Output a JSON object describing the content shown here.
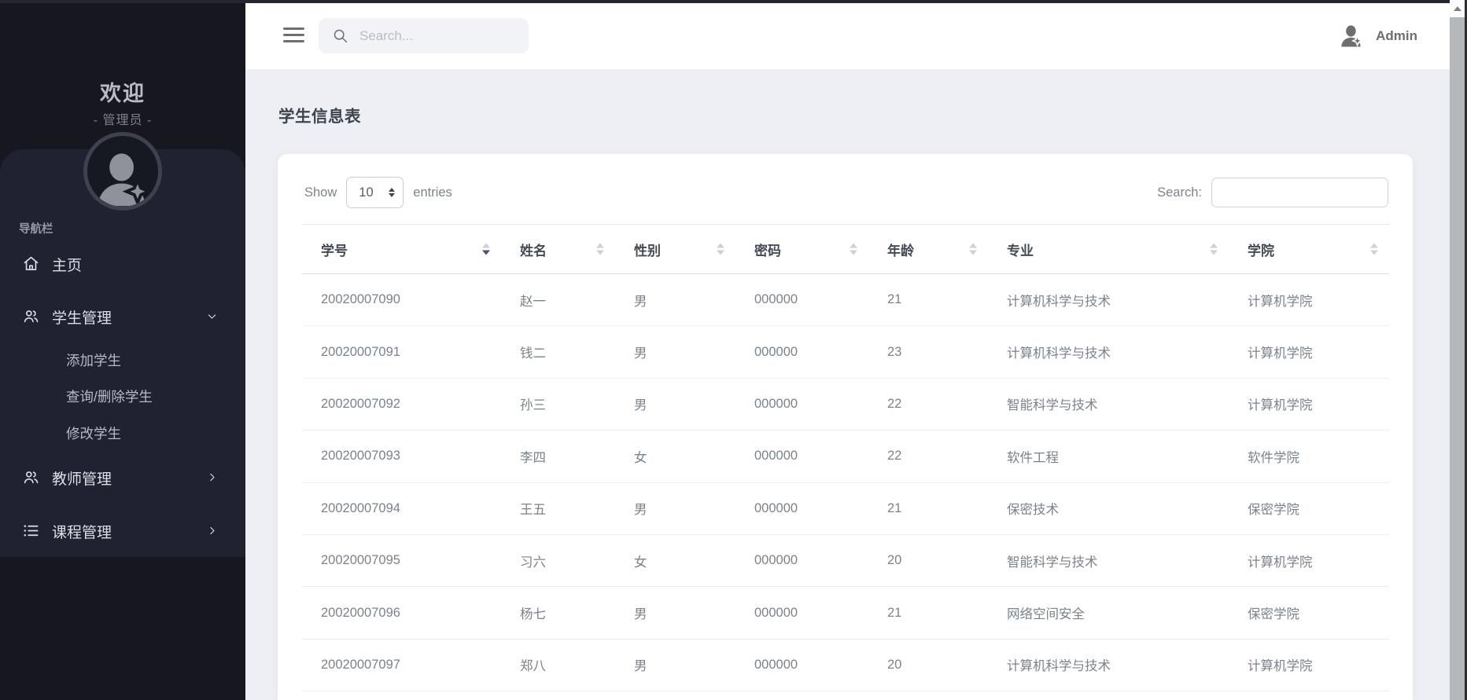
{
  "sidebar": {
    "welcome_title": "欢迎",
    "welcome_subtitle": "- 管理员 -",
    "nav_label": "导航栏",
    "home_label": "主页",
    "student_mgmt_label": "学生管理",
    "student_sub": {
      "add": "添加学生",
      "query_delete": "查询/删除学生",
      "modify": "修改学生"
    },
    "teacher_mgmt_label": "教师管理",
    "course_mgmt_label": "课程管理"
  },
  "topbar": {
    "search_placeholder": "Search...",
    "user_name": "Admin"
  },
  "page": {
    "title": "学生信息表"
  },
  "datatable": {
    "show_label": "Show",
    "entries_label": "entries",
    "page_length": "10",
    "search_label": "Search:",
    "search_value": "",
    "columns": [
      "学号",
      "姓名",
      "性别",
      "密码",
      "年龄",
      "专业",
      "学院"
    ],
    "rows": [
      {
        "id": "20020007090",
        "name": "赵一",
        "gender": "男",
        "password": "000000",
        "age": "21",
        "major": "计算机科学与技术",
        "college": "计算机学院"
      },
      {
        "id": "20020007091",
        "name": "钱二",
        "gender": "男",
        "password": "000000",
        "age": "23",
        "major": "计算机科学与技术",
        "college": "计算机学院"
      },
      {
        "id": "20020007092",
        "name": "孙三",
        "gender": "男",
        "password": "000000",
        "age": "22",
        "major": "智能科学与技术",
        "college": "计算机学院"
      },
      {
        "id": "20020007093",
        "name": "李四",
        "gender": "女",
        "password": "000000",
        "age": "22",
        "major": "软件工程",
        "college": "软件学院"
      },
      {
        "id": "20020007094",
        "name": "王五",
        "gender": "男",
        "password": "000000",
        "age": "21",
        "major": "保密技术",
        "college": "保密学院"
      },
      {
        "id": "20020007095",
        "name": "习六",
        "gender": "女",
        "password": "000000",
        "age": "20",
        "major": "智能科学与技术",
        "college": "计算机学院"
      },
      {
        "id": "20020007096",
        "name": "杨七",
        "gender": "男",
        "password": "000000",
        "age": "21",
        "major": "网络空间安全",
        "college": "保密学院"
      },
      {
        "id": "20020007097",
        "name": "郑八",
        "gender": "男",
        "password": "000000",
        "age": "20",
        "major": "计算机科学与技术",
        "college": "计算机学院"
      }
    ]
  },
  "icons": {
    "menu": "hamburger-icon",
    "search": "search-icon",
    "user": "person-star-icon",
    "home": "home-icon",
    "students": "people-icon",
    "teachers": "people-icon",
    "courses": "list-icon",
    "expanded": "chevron-down-icon",
    "collapsed": "chevron-right-icon",
    "sort": "sort-arrows-icon",
    "scroll_up": "scroll-up-arrow-icon"
  },
  "colors": {
    "sidebar_bg": "#16171f",
    "sidebar_panel_bg": "#202231",
    "topbar_bg": "#ffffff",
    "page_bg": "#edeff4",
    "card_bg": "#ffffff",
    "table_header_text": "#444b55",
    "table_cell_text": "#7b828b",
    "active_sort_arrow": "#47536b"
  }
}
